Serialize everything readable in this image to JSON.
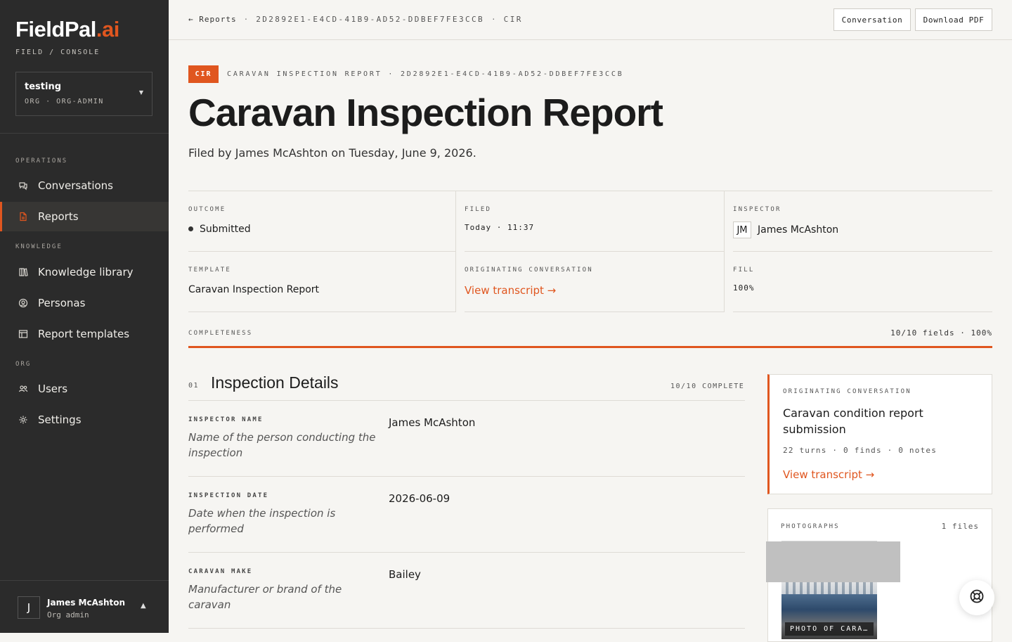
{
  "brand": {
    "name_main": "FieldPal",
    "name_accent": ".ai",
    "subtitle": "FIELD / CONSOLE"
  },
  "org": {
    "name": "testing",
    "role": "ORG · ORG-ADMIN"
  },
  "nav": {
    "sections": {
      "operations": "OPERATIONS",
      "knowledge": "KNOWLEDGE",
      "org": "ORG"
    },
    "items": [
      {
        "label": "Conversations",
        "icon": "chat-icon"
      },
      {
        "label": "Reports",
        "icon": "document-icon",
        "active": true
      },
      {
        "label": "Knowledge library",
        "icon": "books-icon"
      },
      {
        "label": "Personas",
        "icon": "persona-icon"
      },
      {
        "label": "Report templates",
        "icon": "template-icon"
      },
      {
        "label": "Users",
        "icon": "users-icon"
      },
      {
        "label": "Settings",
        "icon": "gear-icon"
      }
    ]
  },
  "user": {
    "initial": "J",
    "name": "James McAshton",
    "role": "Org admin"
  },
  "topbar": {
    "back": "← Reports",
    "report_id": "2D2892E1-E4CD-41B9-AD52-DDBEF7FE3CCB",
    "type_code": "CIR",
    "conversation_button": "Conversation",
    "download_button": "Download PDF"
  },
  "report": {
    "tag": "CIR",
    "eyebrow": "CARAVAN INSPECTION REPORT · 2D2892E1-E4CD-41B9-AD52-DDBEF7FE3CCB",
    "title": "Caravan Inspection Report",
    "filed_line": "Filed by James McAshton on Tuesday, June 9, 2026."
  },
  "meta": {
    "outcome_label": "OUTCOME",
    "outcome_value": "Submitted",
    "filed_label": "FILED",
    "filed_value": "Today · 11:37",
    "inspector_label": "INSPECTOR",
    "inspector_initials": "JM",
    "inspector_value": "James McAshton",
    "template_label": "TEMPLATE",
    "template_value": "Caravan Inspection Report",
    "origin_label": "ORIGINATING CONVERSATION",
    "origin_link": "View transcript →",
    "fill_label": "FILL",
    "fill_value": "100%"
  },
  "completeness": {
    "label": "COMPLETENESS",
    "count": "10/10 fields · 100%",
    "fraction": 1.0
  },
  "section": {
    "number": "01",
    "title": "Inspection Details",
    "complete": "10/10 COMPLETE",
    "fields": [
      {
        "label": "INSPECTOR NAME",
        "help": "Name of the person conducting the inspection",
        "value": "James McAshton"
      },
      {
        "label": "INSPECTION DATE",
        "help": "Date when the inspection is performed",
        "value": "2026-06-09"
      },
      {
        "label": "CARAVAN MAKE",
        "help": "Manufacturer or brand of the caravan",
        "value": "Bailey"
      }
    ]
  },
  "conversation_card": {
    "label": "ORIGINATING CONVERSATION",
    "title": "Caravan condition report submission",
    "stats": "22 turns · 0 finds · 0 notes",
    "link": "View transcript →"
  },
  "photos": {
    "label": "PHOTOGRAPHS",
    "count": "1 files",
    "caption": "PHOTO OF CARA…"
  },
  "colors": {
    "accent": "#e0561f",
    "sidebar": "#2b2b2b",
    "background": "#f6f5f2"
  }
}
